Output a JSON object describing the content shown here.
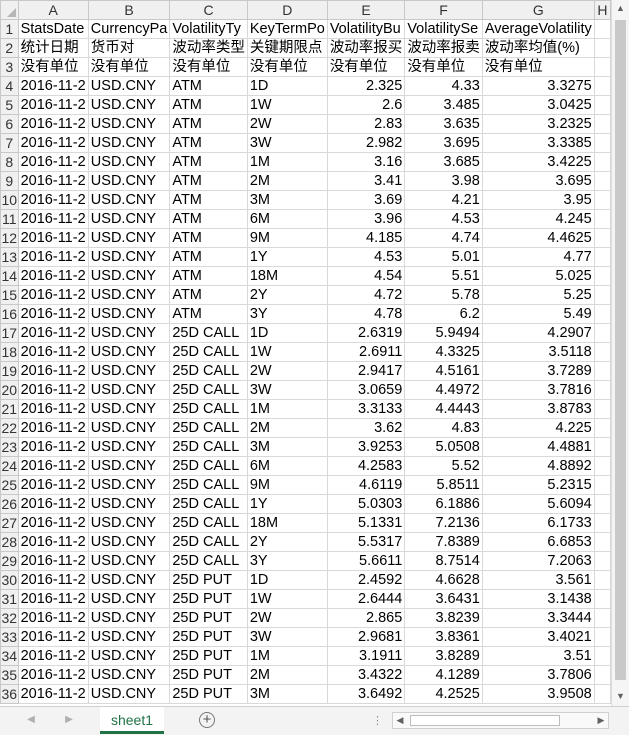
{
  "sheet": {
    "columns": [
      "A",
      "B",
      "C",
      "D",
      "E",
      "F",
      "G",
      "H"
    ],
    "rows": [
      {
        "n": "1",
        "cells": [
          "StatsDate",
          "CurrencyPa",
          "VolatilityTy",
          "KeyTermPo",
          "VolatilityBu",
          "VolatilitySe",
          "AverageVolatility",
          ""
        ]
      },
      {
        "n": "2",
        "cells": [
          "统计日期",
          "货币对",
          "波动率类型",
          "关键期限点",
          "波动率报买",
          "波动率报卖",
          "波动率均值(%)",
          ""
        ]
      },
      {
        "n": "3",
        "cells": [
          "没有单位",
          "没有单位",
          "没有单位",
          "没有单位",
          "没有单位",
          "没有单位",
          "没有单位",
          ""
        ]
      },
      {
        "n": "4",
        "cells": [
          "2016-11-2",
          "USD.CNY",
          "ATM",
          "1D",
          "2.325",
          "4.33",
          "3.3275",
          ""
        ]
      },
      {
        "n": "5",
        "cells": [
          "2016-11-2",
          "USD.CNY",
          "ATM",
          "1W",
          "2.6",
          "3.485",
          "3.0425",
          ""
        ]
      },
      {
        "n": "6",
        "cells": [
          "2016-11-2",
          "USD.CNY",
          "ATM",
          "2W",
          "2.83",
          "3.635",
          "3.2325",
          ""
        ]
      },
      {
        "n": "7",
        "cells": [
          "2016-11-2",
          "USD.CNY",
          "ATM",
          "3W",
          "2.982",
          "3.695",
          "3.3385",
          ""
        ]
      },
      {
        "n": "8",
        "cells": [
          "2016-11-2",
          "USD.CNY",
          "ATM",
          "1M",
          "3.16",
          "3.685",
          "3.4225",
          ""
        ]
      },
      {
        "n": "9",
        "cells": [
          "2016-11-2",
          "USD.CNY",
          "ATM",
          "2M",
          "3.41",
          "3.98",
          "3.695",
          ""
        ]
      },
      {
        "n": "10",
        "cells": [
          "2016-11-2",
          "USD.CNY",
          "ATM",
          "3M",
          "3.69",
          "4.21",
          "3.95",
          ""
        ]
      },
      {
        "n": "11",
        "cells": [
          "2016-11-2",
          "USD.CNY",
          "ATM",
          "6M",
          "3.96",
          "4.53",
          "4.245",
          ""
        ]
      },
      {
        "n": "12",
        "cells": [
          "2016-11-2",
          "USD.CNY",
          "ATM",
          "9M",
          "4.185",
          "4.74",
          "4.4625",
          ""
        ]
      },
      {
        "n": "13",
        "cells": [
          "2016-11-2",
          "USD.CNY",
          "ATM",
          "1Y",
          "4.53",
          "5.01",
          "4.77",
          ""
        ]
      },
      {
        "n": "14",
        "cells": [
          "2016-11-2",
          "USD.CNY",
          "ATM",
          "18M",
          "4.54",
          "5.51",
          "5.025",
          ""
        ]
      },
      {
        "n": "15",
        "cells": [
          "2016-11-2",
          "USD.CNY",
          "ATM",
          "2Y",
          "4.72",
          "5.78",
          "5.25",
          ""
        ]
      },
      {
        "n": "16",
        "cells": [
          "2016-11-2",
          "USD.CNY",
          "ATM",
          "3Y",
          "4.78",
          "6.2",
          "5.49",
          ""
        ]
      },
      {
        "n": "17",
        "cells": [
          "2016-11-2",
          "USD.CNY",
          "25D CALL",
          "1D",
          "2.6319",
          "5.9494",
          "4.2907",
          ""
        ]
      },
      {
        "n": "18",
        "cells": [
          "2016-11-2",
          "USD.CNY",
          "25D CALL",
          "1W",
          "2.6911",
          "4.3325",
          "3.5118",
          ""
        ]
      },
      {
        "n": "19",
        "cells": [
          "2016-11-2",
          "USD.CNY",
          "25D CALL",
          "2W",
          "2.9417",
          "4.5161",
          "3.7289",
          ""
        ]
      },
      {
        "n": "20",
        "cells": [
          "2016-11-2",
          "USD.CNY",
          "25D CALL",
          "3W",
          "3.0659",
          "4.4972",
          "3.7816",
          ""
        ]
      },
      {
        "n": "21",
        "cells": [
          "2016-11-2",
          "USD.CNY",
          "25D CALL",
          "1M",
          "3.3133",
          "4.4443",
          "3.8783",
          ""
        ]
      },
      {
        "n": "22",
        "cells": [
          "2016-11-2",
          "USD.CNY",
          "25D CALL",
          "2M",
          "3.62",
          "4.83",
          "4.225",
          ""
        ]
      },
      {
        "n": "23",
        "cells": [
          "2016-11-2",
          "USD.CNY",
          "25D CALL",
          "3M",
          "3.9253",
          "5.0508",
          "4.4881",
          ""
        ]
      },
      {
        "n": "24",
        "cells": [
          "2016-11-2",
          "USD.CNY",
          "25D CALL",
          "6M",
          "4.2583",
          "5.52",
          "4.8892",
          ""
        ]
      },
      {
        "n": "25",
        "cells": [
          "2016-11-2",
          "USD.CNY",
          "25D CALL",
          "9M",
          "4.6119",
          "5.8511",
          "5.2315",
          ""
        ]
      },
      {
        "n": "26",
        "cells": [
          "2016-11-2",
          "USD.CNY",
          "25D CALL",
          "1Y",
          "5.0303",
          "6.1886",
          "5.6094",
          ""
        ]
      },
      {
        "n": "27",
        "cells": [
          "2016-11-2",
          "USD.CNY",
          "25D CALL",
          "18M",
          "5.1331",
          "7.2136",
          "6.1733",
          ""
        ]
      },
      {
        "n": "28",
        "cells": [
          "2016-11-2",
          "USD.CNY",
          "25D CALL",
          "2Y",
          "5.5317",
          "7.8389",
          "6.6853",
          ""
        ]
      },
      {
        "n": "29",
        "cells": [
          "2016-11-2",
          "USD.CNY",
          "25D CALL",
          "3Y",
          "5.6611",
          "8.7514",
          "7.2063",
          ""
        ]
      },
      {
        "n": "30",
        "cells": [
          "2016-11-2",
          "USD.CNY",
          "25D PUT",
          "1D",
          "2.4592",
          "4.6628",
          "3.561",
          ""
        ]
      },
      {
        "n": "31",
        "cells": [
          "2016-11-2",
          "USD.CNY",
          "25D PUT",
          "1W",
          "2.6444",
          "3.6431",
          "3.1438",
          ""
        ]
      },
      {
        "n": "32",
        "cells": [
          "2016-11-2",
          "USD.CNY",
          "25D PUT",
          "2W",
          "2.865",
          "3.8239",
          "3.3444",
          ""
        ]
      },
      {
        "n": "33",
        "cells": [
          "2016-11-2",
          "USD.CNY",
          "25D PUT",
          "3W",
          "2.9681",
          "3.8361",
          "3.4021",
          ""
        ]
      },
      {
        "n": "34",
        "cells": [
          "2016-11-2",
          "USD.CNY",
          "25D PUT",
          "1M",
          "3.1911",
          "3.8289",
          "3.51",
          ""
        ]
      },
      {
        "n": "35",
        "cells": [
          "2016-11-2",
          "USD.CNY",
          "25D PUT",
          "2M",
          "3.4322",
          "4.1289",
          "3.7806",
          ""
        ]
      },
      {
        "n": "36",
        "cells": [
          "2016-11-2",
          "USD.CNY",
          "25D PUT",
          "3M",
          "3.6492",
          "4.2525",
          "3.9508",
          ""
        ]
      }
    ]
  },
  "tabs": [
    {
      "label": "sheet1",
      "active": true
    }
  ],
  "icons": {
    "add_sheet": "plus-circle-icon",
    "scroll_up": "caret-up-icon",
    "scroll_down": "caret-down-icon",
    "scroll_left": "caret-left-icon",
    "scroll_right": "caret-right-icon"
  },
  "accent_color": "#217346"
}
